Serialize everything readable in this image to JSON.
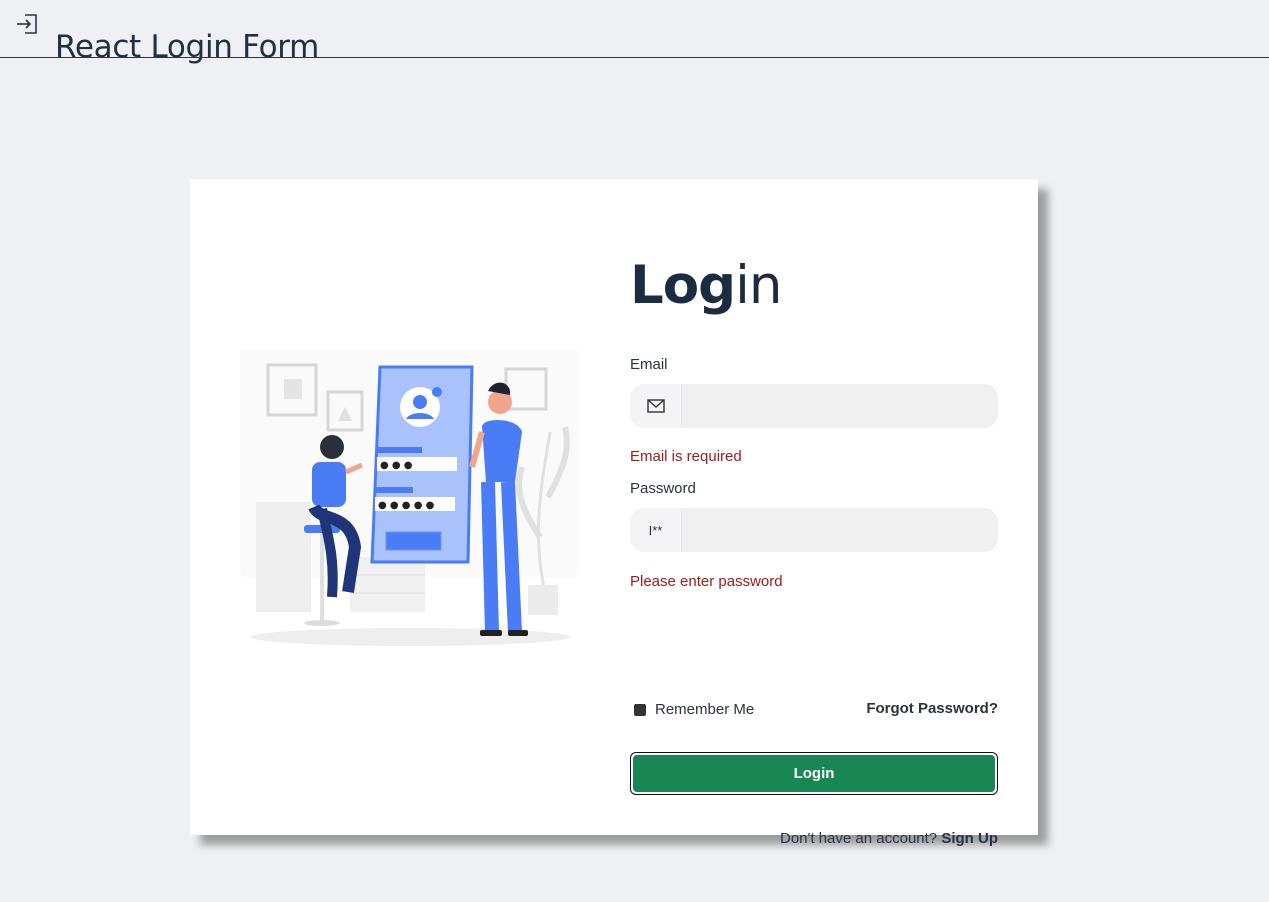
{
  "header": {
    "title": "React Login Form",
    "icon": "login-enter-icon"
  },
  "form": {
    "heading_bold": "Log",
    "heading_light": "in",
    "email": {
      "label": "Email",
      "value": "",
      "placeholder": "",
      "icon": "envelope-icon",
      "error": "Email is required"
    },
    "password": {
      "label": "Password",
      "value": "",
      "placeholder": "",
      "icon_text": "I**",
      "error": "Please enter password"
    },
    "remember_label": "Remember Me",
    "remember_checked": false,
    "forgot_label": "Forgot Password?",
    "login_label": "Login",
    "signup_prompt": "Don't have an account?",
    "signup_label": "Sign Up"
  },
  "colors": {
    "background": "#eff0f4",
    "card": "#ffffff",
    "primary_button": "#198754",
    "error": "#a11b1b",
    "illustration_accent": "#4a7cf6"
  }
}
